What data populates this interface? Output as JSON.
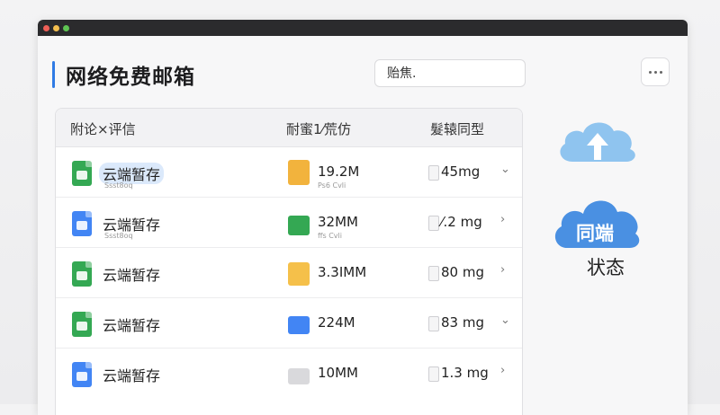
{
  "app": {
    "title": "网络免费邮箱"
  },
  "search": {
    "value": "贻焦."
  },
  "table": {
    "headers": {
      "name": "附论×评信",
      "size": "耐蜜1⁄荒仿",
      "weight": "髮辕同型"
    },
    "rows": [
      {
        "name": "云端暂存",
        "sub": "Ssst8oq",
        "file_icon": "sheet-icon",
        "file_color": "green",
        "type_icon": "folder-icon",
        "type_color": "yellow",
        "size": "19.2M",
        "size_sub": "Ps6 Cvli",
        "weight": "45mg",
        "chevron": "⌄"
      },
      {
        "name": "云端暂存",
        "sub": "Ssst8oq",
        "file_icon": "cloud-doc-icon",
        "file_color": "blue",
        "type_icon": "folder-icon",
        "type_color": "green",
        "size": "32MM",
        "size_sub": "ffs Cvli",
        "weight": "⁄.2 mg",
        "chevron": "›"
      },
      {
        "name": "云端暂存",
        "sub": "",
        "file_icon": "sheet-icon",
        "file_color": "green",
        "type_icon": "folder-icon",
        "type_color": "fyellow",
        "size": "3.3IMM",
        "size_sub": "",
        "weight": "80 mg",
        "chevron": "›"
      },
      {
        "name": "云端暂存",
        "sub": "",
        "file_icon": "sheet-icon",
        "file_color": "green",
        "type_icon": "mail-icon",
        "type_color": "mail",
        "size": "224M",
        "size_sub": "",
        "weight": "83 mg",
        "chevron": "⌄"
      },
      {
        "name": "云端暂存",
        "sub": "",
        "file_icon": "cloud-doc-icon",
        "file_color": "blue",
        "type_icon": "envelope-icon",
        "type_color": "gray",
        "size": "10MM",
        "size_sub": "",
        "weight": "1.3 mg",
        "chevron": "›"
      }
    ]
  },
  "status": {
    "title": "同端",
    "label": "状态"
  },
  "colors": {
    "accent": "#2f7be5",
    "cloud": "#4a90e2",
    "cloud_light": "#8fc4ef"
  }
}
